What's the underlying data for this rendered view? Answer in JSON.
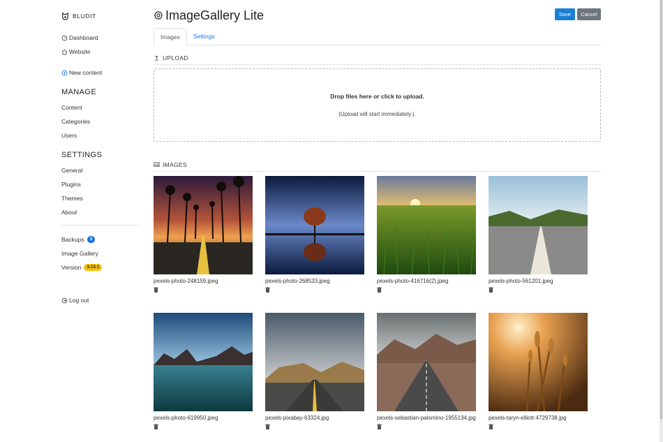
{
  "sidebar": {
    "brand": "BLUDIT",
    "dashboard": "Dashboard",
    "website": "Website",
    "new_content": "New content",
    "manage_title": "MANAGE",
    "manage_items": [
      "Content",
      "Categories",
      "Users"
    ],
    "settings_title": "SETTINGS",
    "settings_items": [
      "General",
      "Plugins",
      "Themes",
      "About"
    ],
    "backups": "Backups",
    "backups_count": "3",
    "image_gallery": "Image Gallery",
    "version": "Version",
    "version_badge": "3.13.1",
    "logout": "Log out"
  },
  "header": {
    "title": "ImageGallery Lite",
    "save": "Save",
    "cancel": "Cancel"
  },
  "tabs": [
    "Images",
    "Settings"
  ],
  "upload": {
    "heading": "UPLOAD",
    "drop_text": "Drop files here or click to upload.",
    "sub_text": "(Upload will start immediately.)."
  },
  "images": {
    "heading": "IMAGES",
    "items": [
      {
        "name": "pexels-photo-248159.jpeg"
      },
      {
        "name": "pexels-photo-268533.jpeg"
      },
      {
        "name": "pexels-photo-416716(2).jpeg"
      },
      {
        "name": "pexels-photo-561201.jpeg"
      },
      {
        "name": "pexels-photo-619950.jpeg"
      },
      {
        "name": "pexels-pixabay-63324.jpg"
      },
      {
        "name": "pexels-sebastian-palomino-1955134.jpg"
      },
      {
        "name": "pexels-taryn-elliott-4729738.jpg"
      }
    ]
  },
  "colors": {
    "accent": "#1a73e8",
    "save_button": "#1a7ed6",
    "cancel_button": "#6c757d",
    "version_badge": "#f5c10a"
  }
}
